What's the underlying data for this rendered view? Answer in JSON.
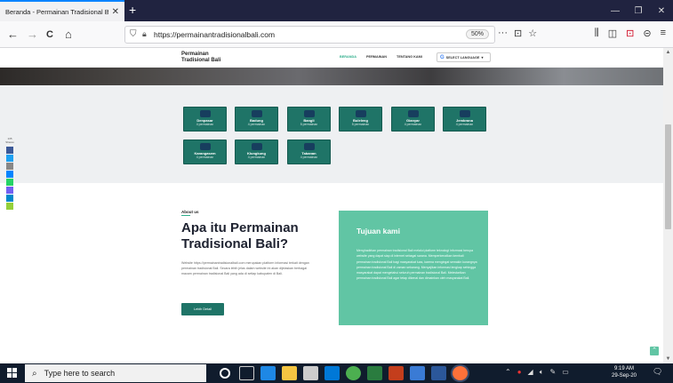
{
  "browser": {
    "tab_title": "Beranda - Permainan Tradisional Ba",
    "tab_close": "✕",
    "new_tab": "+",
    "window_controls": {
      "minimize": "—",
      "restore": "❐",
      "close": "✕"
    },
    "nav": {
      "back": "←",
      "forward": "→",
      "reload": "C",
      "home": "⌂"
    },
    "url": "https://permainantradisionalbali.com",
    "zoom": "50%",
    "url_icons": {
      "more": "···",
      "pocket": "⊡",
      "bookmark": "☆"
    },
    "toolbar_right": {
      "library": "⫼",
      "sidebar": "◫",
      "pocket": "⊡",
      "account": "⊝",
      "menu": "≡"
    }
  },
  "site": {
    "logo_line1": "Permainan",
    "logo_line2": "Tradisional Bali",
    "menu": [
      "BERANDA",
      "PERMAINAN",
      "TENTANG KAMI"
    ],
    "language": "SELECT LANGUAGE",
    "language_g": "G",
    "language_caret": "▾",
    "share_count": "135",
    "share_label": "Shares",
    "regions": [
      {
        "name": "Denpasar",
        "count": "4 permainan"
      },
      {
        "name": "Badung",
        "count": "4 permainan"
      },
      {
        "name": "Bangli",
        "count": "5 permainan"
      },
      {
        "name": "Buleleng",
        "count": "5 permainan"
      },
      {
        "name": "Gianyar",
        "count": "4 permainan"
      },
      {
        "name": "Jembrana",
        "count": "4 permainan"
      },
      {
        "name": "Karangasem",
        "count": "4 permainan"
      },
      {
        "name": "Klungkung",
        "count": "4 permainan"
      },
      {
        "name": "Tabanan",
        "count": "4 permainan"
      }
    ],
    "about_label": "About us",
    "about_title": "Apa itu Permainan Tradisional Bali?",
    "about_text": "Website https://permainantradisionalbali.com merupakan platform informasi terkait dengan permainan tradisional Bali. Secara lebih jelas dalam website ini akan dijelaskan berbagai macam permainan tradisional Bali yang ada di setiap kabupaten di Bali.",
    "about_button": "Lebih Detail",
    "tujuan_title": "Tujuan kami",
    "tujuan_text": "Menghadirkan permainan tradisional Bali melalui platform teknologi informasi berupa website yang dapat siap di internet sebagai sarana. Memperkenalkan kembali permainan tradisional Bali bagi masyarakat luas, karena mengingat semakin kurangnya permainan tradisional Bali di zaman sekarang. Menyajikan informasi lengkap sehingga masyarakat dapat mengetahui seluruh permainan tradisional Bali. Melestarikan permainan tradisional Bali agar tetap dikenal dan dimainkan oleh masyarakat Bali.",
    "back_to_top": "⌃"
  },
  "taskbar": {
    "search_placeholder": "Type here to search",
    "search_icon": "⌕",
    "tray_caret": "⌃",
    "time": "9:19 AM",
    "date": "29-Sep-20",
    "notification": "🗨"
  },
  "colors": {
    "accent": "#61c5a4",
    "dark_green": "#1f7467",
    "firefox_dark": "#202340",
    "taskbar": "#101c2d"
  }
}
